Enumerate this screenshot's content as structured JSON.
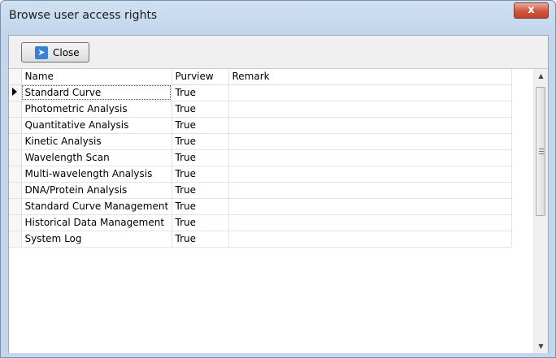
{
  "window": {
    "title": "Browse user access rights",
    "close_glyph": "x"
  },
  "toolbar": {
    "close_label": "Close",
    "close_icon": "exit-run-icon"
  },
  "table": {
    "columns": [
      "Name",
      "Purview",
      "Remark"
    ],
    "rows": [
      {
        "name": "Standard Curve",
        "purview": "True",
        "remark": ""
      },
      {
        "name": "Photometric Analysis",
        "purview": "True",
        "remark": ""
      },
      {
        "name": "Quantitative Analysis",
        "purview": "True",
        "remark": ""
      },
      {
        "name": "Kinetic Analysis",
        "purview": "True",
        "remark": ""
      },
      {
        "name": "Wavelength Scan",
        "purview": "True",
        "remark": ""
      },
      {
        "name": "Multi-wavelength Analysis",
        "purview": "True",
        "remark": ""
      },
      {
        "name": "DNA/Protein Analysis",
        "purview": "True",
        "remark": ""
      },
      {
        "name": "Standard Curve Management",
        "purview": "True",
        "remark": ""
      },
      {
        "name": "Historical Data Management",
        "purview": "True",
        "remark": ""
      },
      {
        "name": "System Log",
        "purview": "True",
        "remark": ""
      }
    ]
  }
}
